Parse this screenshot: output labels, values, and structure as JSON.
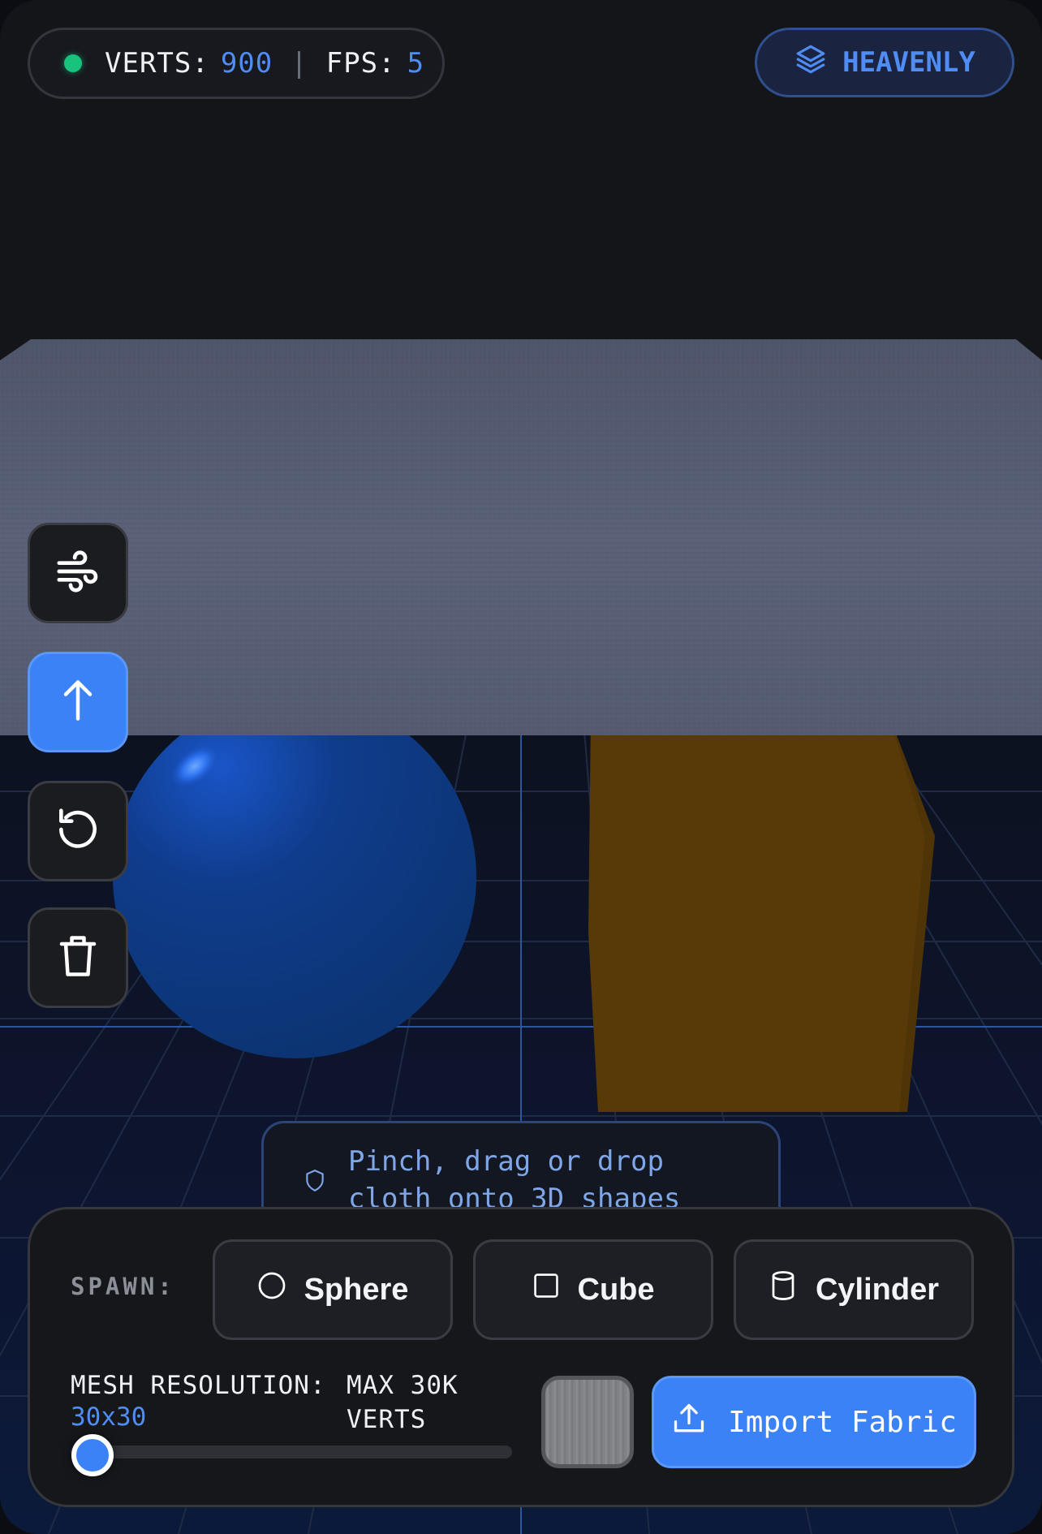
{
  "hud": {
    "verts_label": "VERTS:",
    "verts_value": "900",
    "separator": "|",
    "fps_label": "FPS:",
    "fps_value": "5",
    "preset_label": "HEAVENLY",
    "preset_icon": "layers-icon"
  },
  "toolbar": {
    "tools": [
      {
        "name": "wind",
        "icon": "wind-icon",
        "active": false
      },
      {
        "name": "lift",
        "icon": "arrow-up-icon",
        "active": true
      },
      {
        "name": "reset",
        "icon": "rotate-ccw-icon",
        "active": false
      },
      {
        "name": "delete",
        "icon": "trash-icon",
        "active": false
      }
    ]
  },
  "hint": {
    "icon": "shield-icon",
    "text": "Pinch, drag or drop cloth onto 3D shapes"
  },
  "panel": {
    "spawn_label": "SPAWN:",
    "spawn_buttons": [
      {
        "label": "Sphere",
        "icon": "circle-icon"
      },
      {
        "label": "Cube",
        "icon": "square-icon"
      },
      {
        "label": "Cylinder",
        "icon": "cylinder-icon"
      }
    ],
    "resolution_label": "MESH RESOLUTION:",
    "resolution_value": "30x30",
    "resolution_limit": "MAX 30K VERTS",
    "resolution_slider_fraction": 0.05,
    "import_label": "Import Fabric",
    "import_icon": "upload-icon"
  },
  "colors": {
    "accent": "#3b82f6",
    "status_ok": "#19c37d",
    "sphere": "#0f3b86",
    "cube": "#573a08",
    "cloth": "#525a70"
  }
}
